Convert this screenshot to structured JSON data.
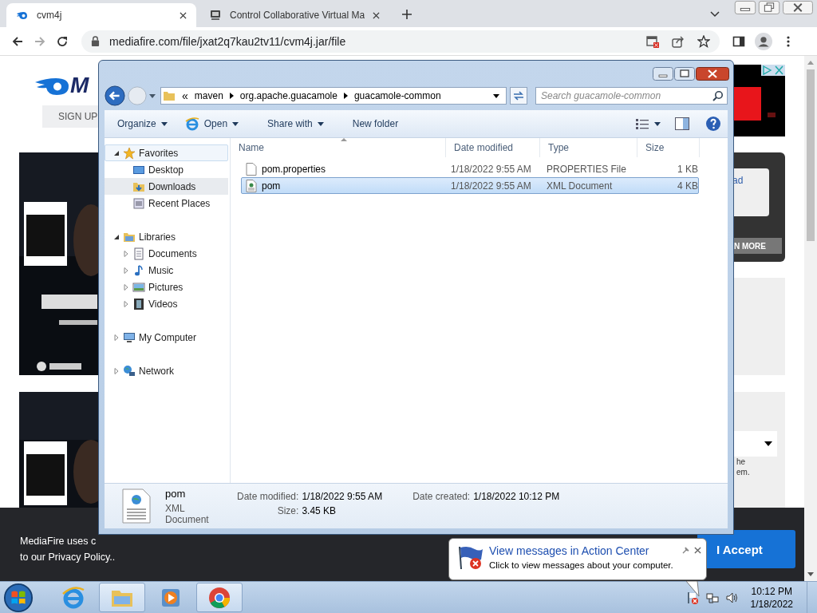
{
  "browser": {
    "tabs": [
      {
        "title": "cvm4j",
        "selected": true,
        "kind": "mediafire"
      },
      {
        "title": "Control Collaborative Virtual Ma",
        "selected": false,
        "kind": "cvm"
      }
    ],
    "url": "mediafire.com/file/jxat2q7kau2tv11/cvm4j.jar/file"
  },
  "page": {
    "logo_text": "M",
    "signup": "SIGN UP",
    "right_link": "ad",
    "right_button": "N MORE",
    "right_text_1": "he",
    "right_text_2": "em.",
    "cookie": {
      "text": "MediaFire uses c",
      "text_2": "to our Privacy Policy..",
      "accept": "I Accept"
    }
  },
  "explorer": {
    "overflow": "«",
    "breadcrumb": [
      "maven",
      "org.apache.guacamole",
      "guacamole-common"
    ],
    "search_placeholder": "Search guacamole-common",
    "toolbar": [
      {
        "label": "Organize",
        "kind": "menu"
      },
      {
        "label": "Open",
        "kind": "open"
      },
      {
        "label": "Share with",
        "kind": "menu"
      },
      {
        "label": "New folder",
        "kind": "plain"
      }
    ],
    "nav": [
      {
        "label": "Favorites",
        "kind": "star",
        "expanded": true,
        "selected": false,
        "children": [
          {
            "label": "Desktop",
            "kind": "desktop",
            "selected": false
          },
          {
            "label": "Downloads",
            "kind": "downloads",
            "selected": true
          },
          {
            "label": "Recent Places",
            "kind": "recent",
            "selected": false
          }
        ]
      },
      {
        "label": "Libraries",
        "kind": "libraries",
        "expanded": true,
        "selected": false,
        "children": [
          {
            "label": "Documents",
            "kind": "documents",
            "expanded": false,
            "selected": false
          },
          {
            "label": "Music",
            "kind": "music",
            "expanded": false,
            "selected": false
          },
          {
            "label": "Pictures",
            "kind": "pictures",
            "expanded": false,
            "selected": false
          },
          {
            "label": "Videos",
            "kind": "videos",
            "expanded": false,
            "selected": false
          }
        ]
      },
      {
        "label": "My Computer",
        "kind": "computer",
        "expanded": false,
        "selected": false
      },
      {
        "label": "Network",
        "kind": "network",
        "expanded": false,
        "selected": false
      }
    ],
    "columns": [
      "Name",
      "Date modified",
      "Type",
      "Size"
    ],
    "files": [
      {
        "name": "pom.properties",
        "date": "1/18/2022 9:55 AM",
        "type": "PROPERTIES File",
        "size": "1 KB",
        "kind": "file",
        "selected": false
      },
      {
        "name": "pom",
        "date": "1/18/2022 9:55 AM",
        "type": "XML Document",
        "size": "4 KB",
        "kind": "xml",
        "selected": true
      }
    ],
    "details": {
      "name": "pom",
      "type": "XML Document",
      "modified_label": "Date modified:",
      "modified": "1/18/2022 9:55 AM",
      "size_label": "Size:",
      "size": "3.45 KB",
      "created_label": "Date created:",
      "created": "1/18/2022 10:12 PM"
    }
  },
  "balloon": {
    "title": "View messages in Action Center",
    "text": "Click to view messages about your computer."
  },
  "taskbar": {
    "apps": [
      {
        "kind": "ie",
        "active": false
      },
      {
        "kind": "explorer",
        "active": true
      },
      {
        "kind": "media",
        "active": false
      },
      {
        "kind": "chrome",
        "active": true
      }
    ],
    "time": "10:12 PM",
    "date": "1/18/2022"
  }
}
